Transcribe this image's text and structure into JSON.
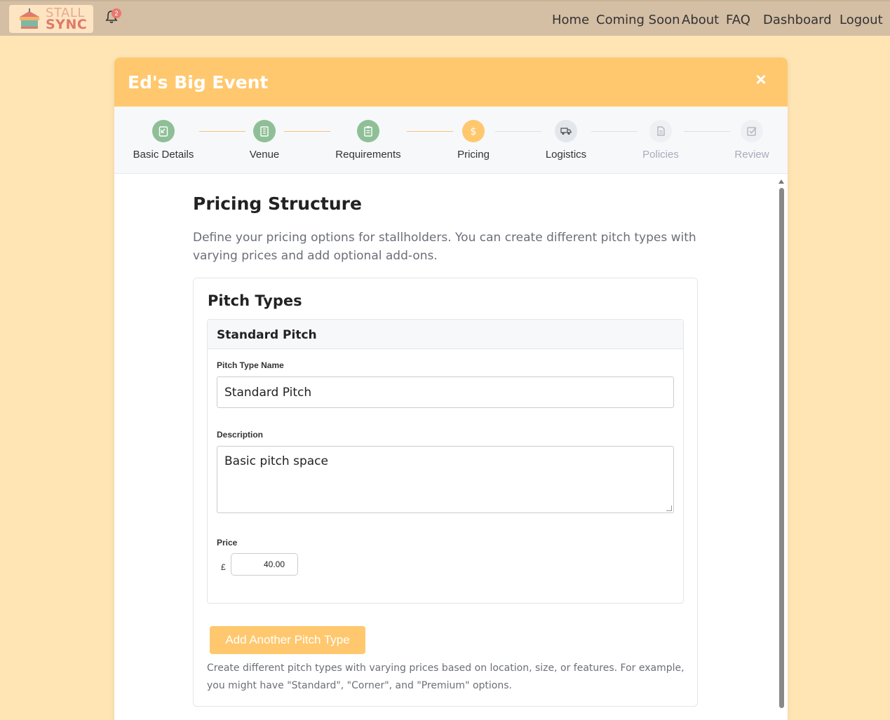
{
  "brand": {
    "line1": "STALL",
    "line2": "SYNC"
  },
  "notifications": {
    "count": "2"
  },
  "nav": {
    "home": "Home",
    "coming_soon": "Coming Soon",
    "about": "About",
    "faq": "FAQ",
    "dashboard": "Dashboard",
    "logout": "Logout"
  },
  "modal": {
    "title": "Ed's Big Event",
    "close": "×"
  },
  "steps": [
    {
      "label": "Basic Details",
      "state": "done",
      "icon": "check-clipboard-icon"
    },
    {
      "label": "Venue",
      "state": "done",
      "icon": "building-icon"
    },
    {
      "label": "Requirements",
      "state": "done",
      "icon": "clipboard-icon"
    },
    {
      "label": "Pricing",
      "state": "active",
      "icon": "dollar-icon"
    },
    {
      "label": "Logistics",
      "state": "todo",
      "icon": "truck-icon"
    },
    {
      "label": "Policies",
      "state": "future",
      "icon": "document-icon"
    },
    {
      "label": "Review",
      "state": "future",
      "icon": "checkbox-icon"
    }
  ],
  "section": {
    "title": "Pricing Structure",
    "intro": "Define your pricing options for stallholders. You can create different pitch types with varying prices and add optional add-ons."
  },
  "pitch_types": {
    "title": "Pitch Types",
    "item_header": "Standard Pitch",
    "name_label": "Pitch Type Name",
    "name_value": "Standard Pitch",
    "desc_label": "Description",
    "desc_value": "Basic pitch space",
    "price_label": "Price",
    "currency": "£",
    "price_value": "40.00",
    "add_button": "Add Another Pitch Type",
    "help": "Create different pitch types with varying prices based on location, size, or features. For example, you might have \"Standard\", \"Corner\", and \"Premium\" options."
  },
  "colors": {
    "accent": "#ffc86e",
    "done": "#8fbf96",
    "nav_bg": "#d4bea4",
    "page_bg": "#ffe5b4"
  }
}
